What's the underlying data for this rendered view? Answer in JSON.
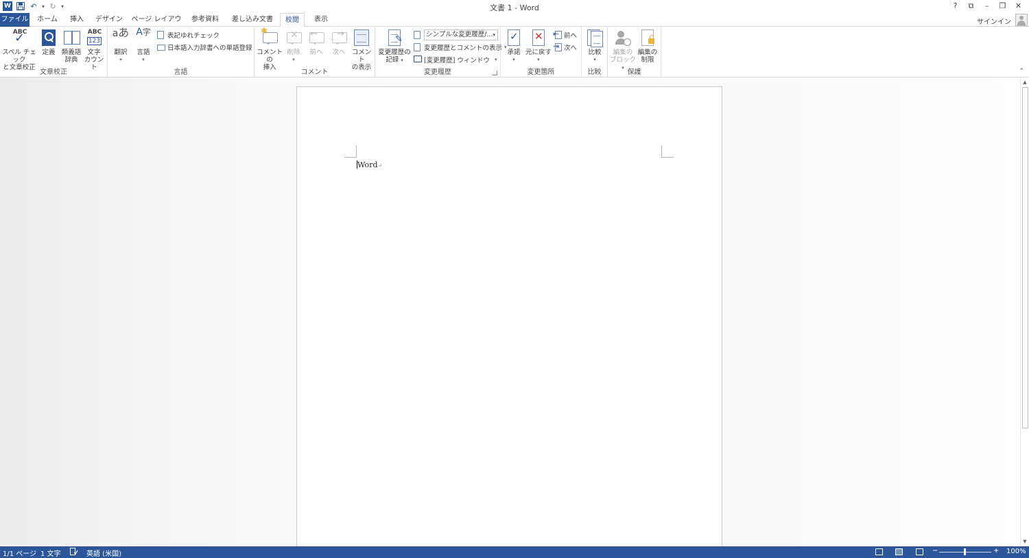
{
  "window": {
    "title": "文書 1 - Word",
    "controls": {
      "help": "?",
      "ribbon_display": "⧉",
      "minimize": "–",
      "restore": "❐",
      "close": "✕"
    }
  },
  "qat": {
    "undo": "↶",
    "redo": "↻",
    "customize": "▾"
  },
  "tabs": [
    {
      "label": "ファイル"
    },
    {
      "label": "ホーム"
    },
    {
      "label": "挿入"
    },
    {
      "label": "デザイン"
    },
    {
      "label": "ページ レイアウト"
    },
    {
      "label": "参考資料"
    },
    {
      "label": "差し込み文書"
    },
    {
      "label": "校閲"
    },
    {
      "label": "表示"
    }
  ],
  "active_tab": "校閲",
  "signin": "サインイン",
  "ribbon": {
    "proofing": {
      "label": "文章校正",
      "spell_line1": "スペル チェック",
      "spell_line2": "と文章校正",
      "define": "定義",
      "thesaurus_line1": "類義語",
      "thesaurus_line2": "辞典",
      "wordcount_line1": "文字",
      "wordcount_line2": "カウント",
      "abc": "ABC",
      "num": "123"
    },
    "language": {
      "label": "言語",
      "translate": "翻訳",
      "language": "言語",
      "consistency": "表記ゆれチェック",
      "register_word": "日本語入力辞書への単語登録"
    },
    "comments": {
      "label": "コメント",
      "new_line1": "コメントの",
      "new_line2": "挿入",
      "delete": "削除",
      "previous": "前へ",
      "next": "次へ",
      "show_line1": "コメント",
      "show_line2": "の表示"
    },
    "tracking": {
      "label": "変更履歴",
      "track_line1": "変更履歴の",
      "track_line2": "記録",
      "display_mode": "シンプルな変更履歴/...",
      "show_markup": "変更履歴とコメントの表示",
      "reviewing_pane": "[変更履歴] ウィンドウ"
    },
    "changes": {
      "label": "変更箇所",
      "accept": "承諾",
      "reject": "元に戻す",
      "previous": "前へ",
      "next": "次へ"
    },
    "compare": {
      "label": "比較",
      "compare": "比較"
    },
    "protect": {
      "label": "保護",
      "block_line1": "編集の",
      "block_line2": "ブロック",
      "restrict_line1": "編集の",
      "restrict_line2": "制限"
    }
  },
  "document": {
    "text": "Word",
    "paragraph_mark": "↵"
  },
  "statusbar": {
    "page": "1/1 ページ",
    "words": "1 文字",
    "language": "英語 (米国)",
    "zoom": "100%",
    "zoom_minus": "−",
    "zoom_plus": "+"
  }
}
